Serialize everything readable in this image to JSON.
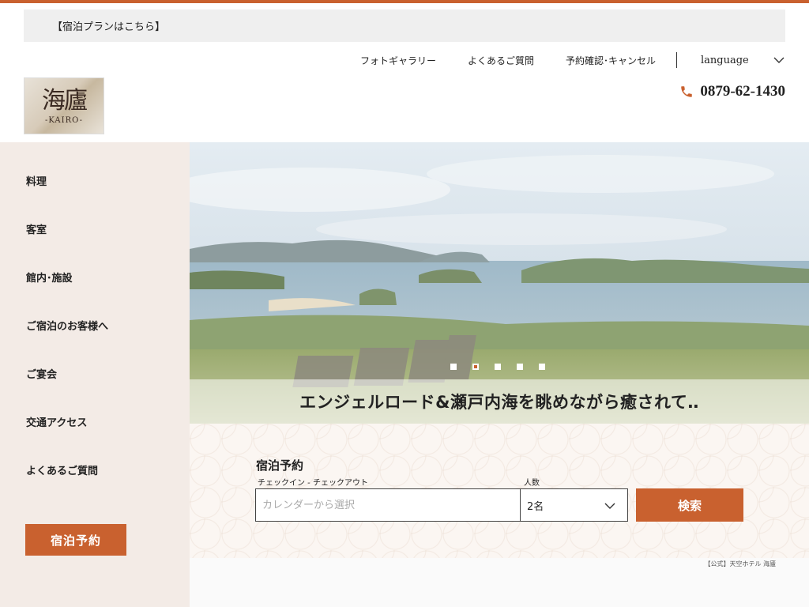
{
  "banner": {
    "text": "【宿泊プランはこちら】"
  },
  "nav": {
    "items": [
      "フォトギャラリー",
      "よくあるご質問",
      "予約確認･キャンセル"
    ],
    "language": "language"
  },
  "logo": {
    "kanji": "海廬",
    "roman": "-KAIRO-"
  },
  "phone": {
    "number": "0879-62-1430"
  },
  "sidebar": {
    "items": [
      "料理",
      "客室",
      "館内･施設",
      "ご宿泊のお客様へ",
      "ご宴会",
      "交通アクセス",
      "よくあるご質問"
    ],
    "reserve_label": "宿泊予約"
  },
  "hero": {
    "caption": "エンジェルロード&瀬戸内海を眺めながら癒されて‥",
    "slide_count": 5,
    "active_slide": 2
  },
  "booking": {
    "title": "宿泊予約",
    "dates_label": "チェックイン - チェックアウト",
    "dates_placeholder": "カレンダーから選択",
    "people_label": "人数",
    "people_value": "2名",
    "search_label": "検索"
  },
  "footer": {
    "credit": "【公式】天空ホテル 海廬"
  },
  "colors": {
    "accent": "#c9612f",
    "sidebar_bg": "#f3ebe6",
    "banner_bg": "#efefef"
  }
}
